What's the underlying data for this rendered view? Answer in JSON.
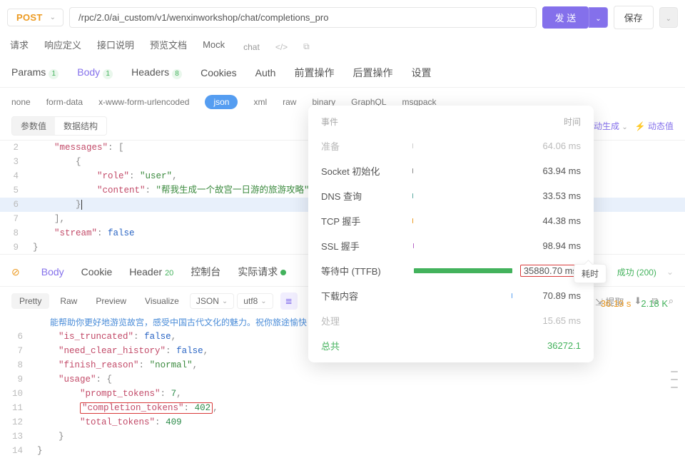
{
  "top": {
    "method": "POST",
    "url": "/rpc/2.0/ai_custom/v1/wenxinworkshop/chat/completions_pro",
    "send": "发 送",
    "save": "保存"
  },
  "mainTabs": {
    "request": "请求",
    "respDef": "响应定义",
    "apiDoc": "接口说明",
    "preview": "预览文档",
    "mock": "Mock",
    "chat": "chat"
  },
  "reqTabs": {
    "params": "Params",
    "paramsBadge": "1",
    "body": "Body",
    "bodyBadge": "1",
    "headers": "Headers",
    "headersBadge": "8",
    "cookies": "Cookies",
    "auth": "Auth",
    "pre": "前置操作",
    "post": "后置操作",
    "settings": "设置"
  },
  "bodyTypes": {
    "none": "none",
    "formdata": "form-data",
    "xwww": "x-www-form-urlencoded",
    "json": "json",
    "xml": "xml",
    "raw": "raw",
    "binary": "binary",
    "graphql": "GraphQL",
    "msgpack": "msgpack"
  },
  "editorSub": {
    "value": "参数值",
    "struct": "数据结构",
    "autogen": "动生成",
    "dynamic": "动态值"
  },
  "reqCode": {
    "l2a": "\"messages\"",
    "l2b": ": [",
    "l3": "{",
    "l4a": "\"role\"",
    "l4b": ": ",
    "l4c": "\"user\"",
    "l4d": ",",
    "l5a": "\"content\"",
    "l5b": ": ",
    "l5c": "\"帮我生成一个故宫一日游的旅游攻略\"",
    "l6a": "}",
    "l7": "],",
    "l8a": "\"stream\"",
    "l8b": ": ",
    "l8c": "false",
    "l9": "}",
    "lineNums": {
      "l2": "2",
      "l3": "3",
      "l4": "4",
      "l5": "5",
      "l6": "6",
      "l7": "7",
      "l8": "8",
      "l9": "9"
    }
  },
  "respTabs": {
    "body": "Body",
    "cookie": "Cookie",
    "header": "Header",
    "headerBadge": "20",
    "console": "控制台",
    "realReq": "实际请求",
    "ok": "成功 (200)"
  },
  "respTool": {
    "pretty": "Pretty",
    "raw": "Raw",
    "preview": "Preview",
    "visualize": "Visualize",
    "json": "JSON",
    "utf8": "utf8",
    "extract": "提取"
  },
  "summary": {
    "code": "200",
    "time": "36.19 s",
    "size": "2.18 K"
  },
  "respCode": {
    "truncated1": "能帮助你更好地游览故宫，感受中国古代文化的魅力。祝你旅途愉快！",
    "truncated2": "\",",
    "lines": {
      "6": {
        "key": "\"is_truncated\"",
        "sep": ": ",
        "val": "false",
        "end": ","
      },
      "7": {
        "key": "\"need_clear_history\"",
        "sep": ": ",
        "val": "false",
        "end": ","
      },
      "8": {
        "key": "\"finish_reason\"",
        "sep": ": ",
        "val": "\"normal\"",
        "end": ","
      },
      "9": {
        "key": "\"usage\"",
        "sep": ": {",
        "val": "",
        "end": ""
      },
      "10": {
        "key": "\"prompt_tokens\"",
        "sep": ": ",
        "val": "7",
        "end": ","
      },
      "11": {
        "key": "\"completion_tokens\"",
        "sep": ": ",
        "val": "402",
        "end": ","
      },
      "12": {
        "key": "\"total_tokens\"",
        "sep": ": ",
        "val": "409",
        "end": ""
      },
      "13": {
        "key": "}",
        "sep": "",
        "val": "",
        "end": ""
      },
      "14": {
        "key": "}",
        "sep": "",
        "val": "",
        "end": ""
      }
    },
    "ln": {
      "6": "6",
      "7": "7",
      "8": "8",
      "9": "9",
      "10": "10",
      "11": "11",
      "12": "12",
      "13": "13",
      "14": "14"
    }
  },
  "timing": {
    "header": {
      "event": "事件",
      "time": "时间"
    },
    "prep": {
      "label": "准备",
      "val": "64.06 ms"
    },
    "socket": {
      "label": "Socket 初始化",
      "val": "63.94 ms"
    },
    "dns": {
      "label": "DNS 查询",
      "val": "33.53 ms"
    },
    "tcp": {
      "label": "TCP 握手",
      "val": "44.38 ms"
    },
    "ssl": {
      "label": "SSL 握手",
      "val": "98.94 ms"
    },
    "ttfb": {
      "label": "等待中 (TTFB)",
      "val": "35880.70 ms"
    },
    "download": {
      "label": "下载内容",
      "val": "70.89 ms"
    },
    "process": {
      "label": "处理",
      "val": "15.65 ms"
    },
    "total": {
      "label": "总共",
      "val": "36272.1"
    }
  },
  "tooltip": "耗时",
  "icons": {
    "chev": "⌄",
    "code": "</>",
    "boxes": "⧉",
    "download": "⬇",
    "copy": "⧉",
    "search": "⌕",
    "menu": "≣",
    "warn": "⊘",
    "bolt": "⚡",
    "extract": "⇲"
  }
}
